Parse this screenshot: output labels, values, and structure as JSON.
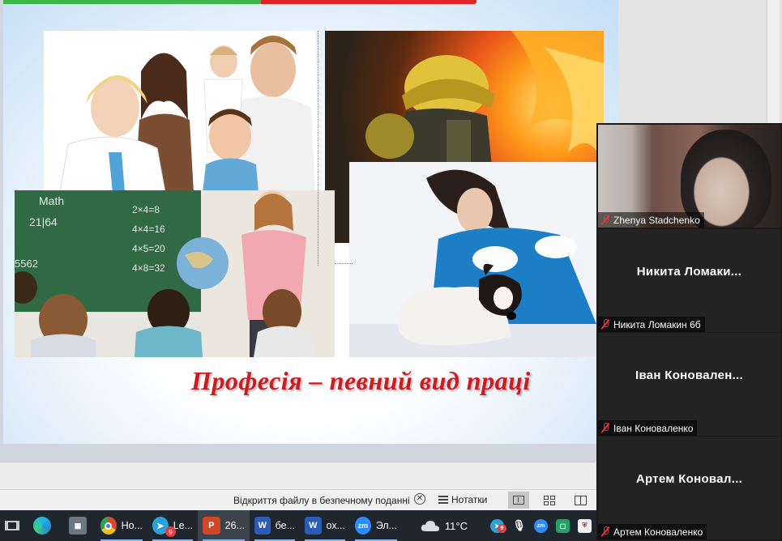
{
  "slide": {
    "title": "Професія – певний  вид  праці"
  },
  "statusbar": {
    "message": "Відкриття файлу в безпечному поданні",
    "notes_label": "Нотатки"
  },
  "zoom": {
    "participants": [
      {
        "display_name": "Zhenya Stadchenko",
        "big_name": "",
        "muted": true,
        "video": true
      },
      {
        "display_name": "Никита Ломакин 6б",
        "big_name": "Никита  Ломаки...",
        "muted": true,
        "video": false
      },
      {
        "display_name": "Іван Коноваленко",
        "big_name": "Іван  Коновален...",
        "muted": true,
        "video": false
      },
      {
        "display_name": "Артем Коноваленко",
        "big_name": "Артем  Коновал...",
        "muted": true,
        "video": false
      }
    ]
  },
  "taskbar": {
    "items": [
      {
        "label": "",
        "icon": "task-view-icon"
      },
      {
        "label": "",
        "icon": "edge-icon"
      },
      {
        "label": "",
        "icon": "calculator-icon"
      },
      {
        "label": "Но...",
        "icon": "chrome-icon"
      },
      {
        "label": "Le...",
        "icon": "telegram-icon",
        "badge": "9"
      },
      {
        "label": "26...",
        "icon": "powerpoint-icon",
        "active": true
      },
      {
        "label": "бе...",
        "icon": "word-icon"
      },
      {
        "label": "ох...",
        "icon": "word-icon"
      },
      {
        "label": "Эл...",
        "icon": "zoom-icon"
      }
    ],
    "weather": "11°C",
    "tray_badge": "9"
  },
  "colors": {
    "title_red": "#d1181f",
    "taskbar_bg": "#20262e",
    "zoom_bg": "#1a1a1a",
    "mute_red": "#e0363a"
  }
}
